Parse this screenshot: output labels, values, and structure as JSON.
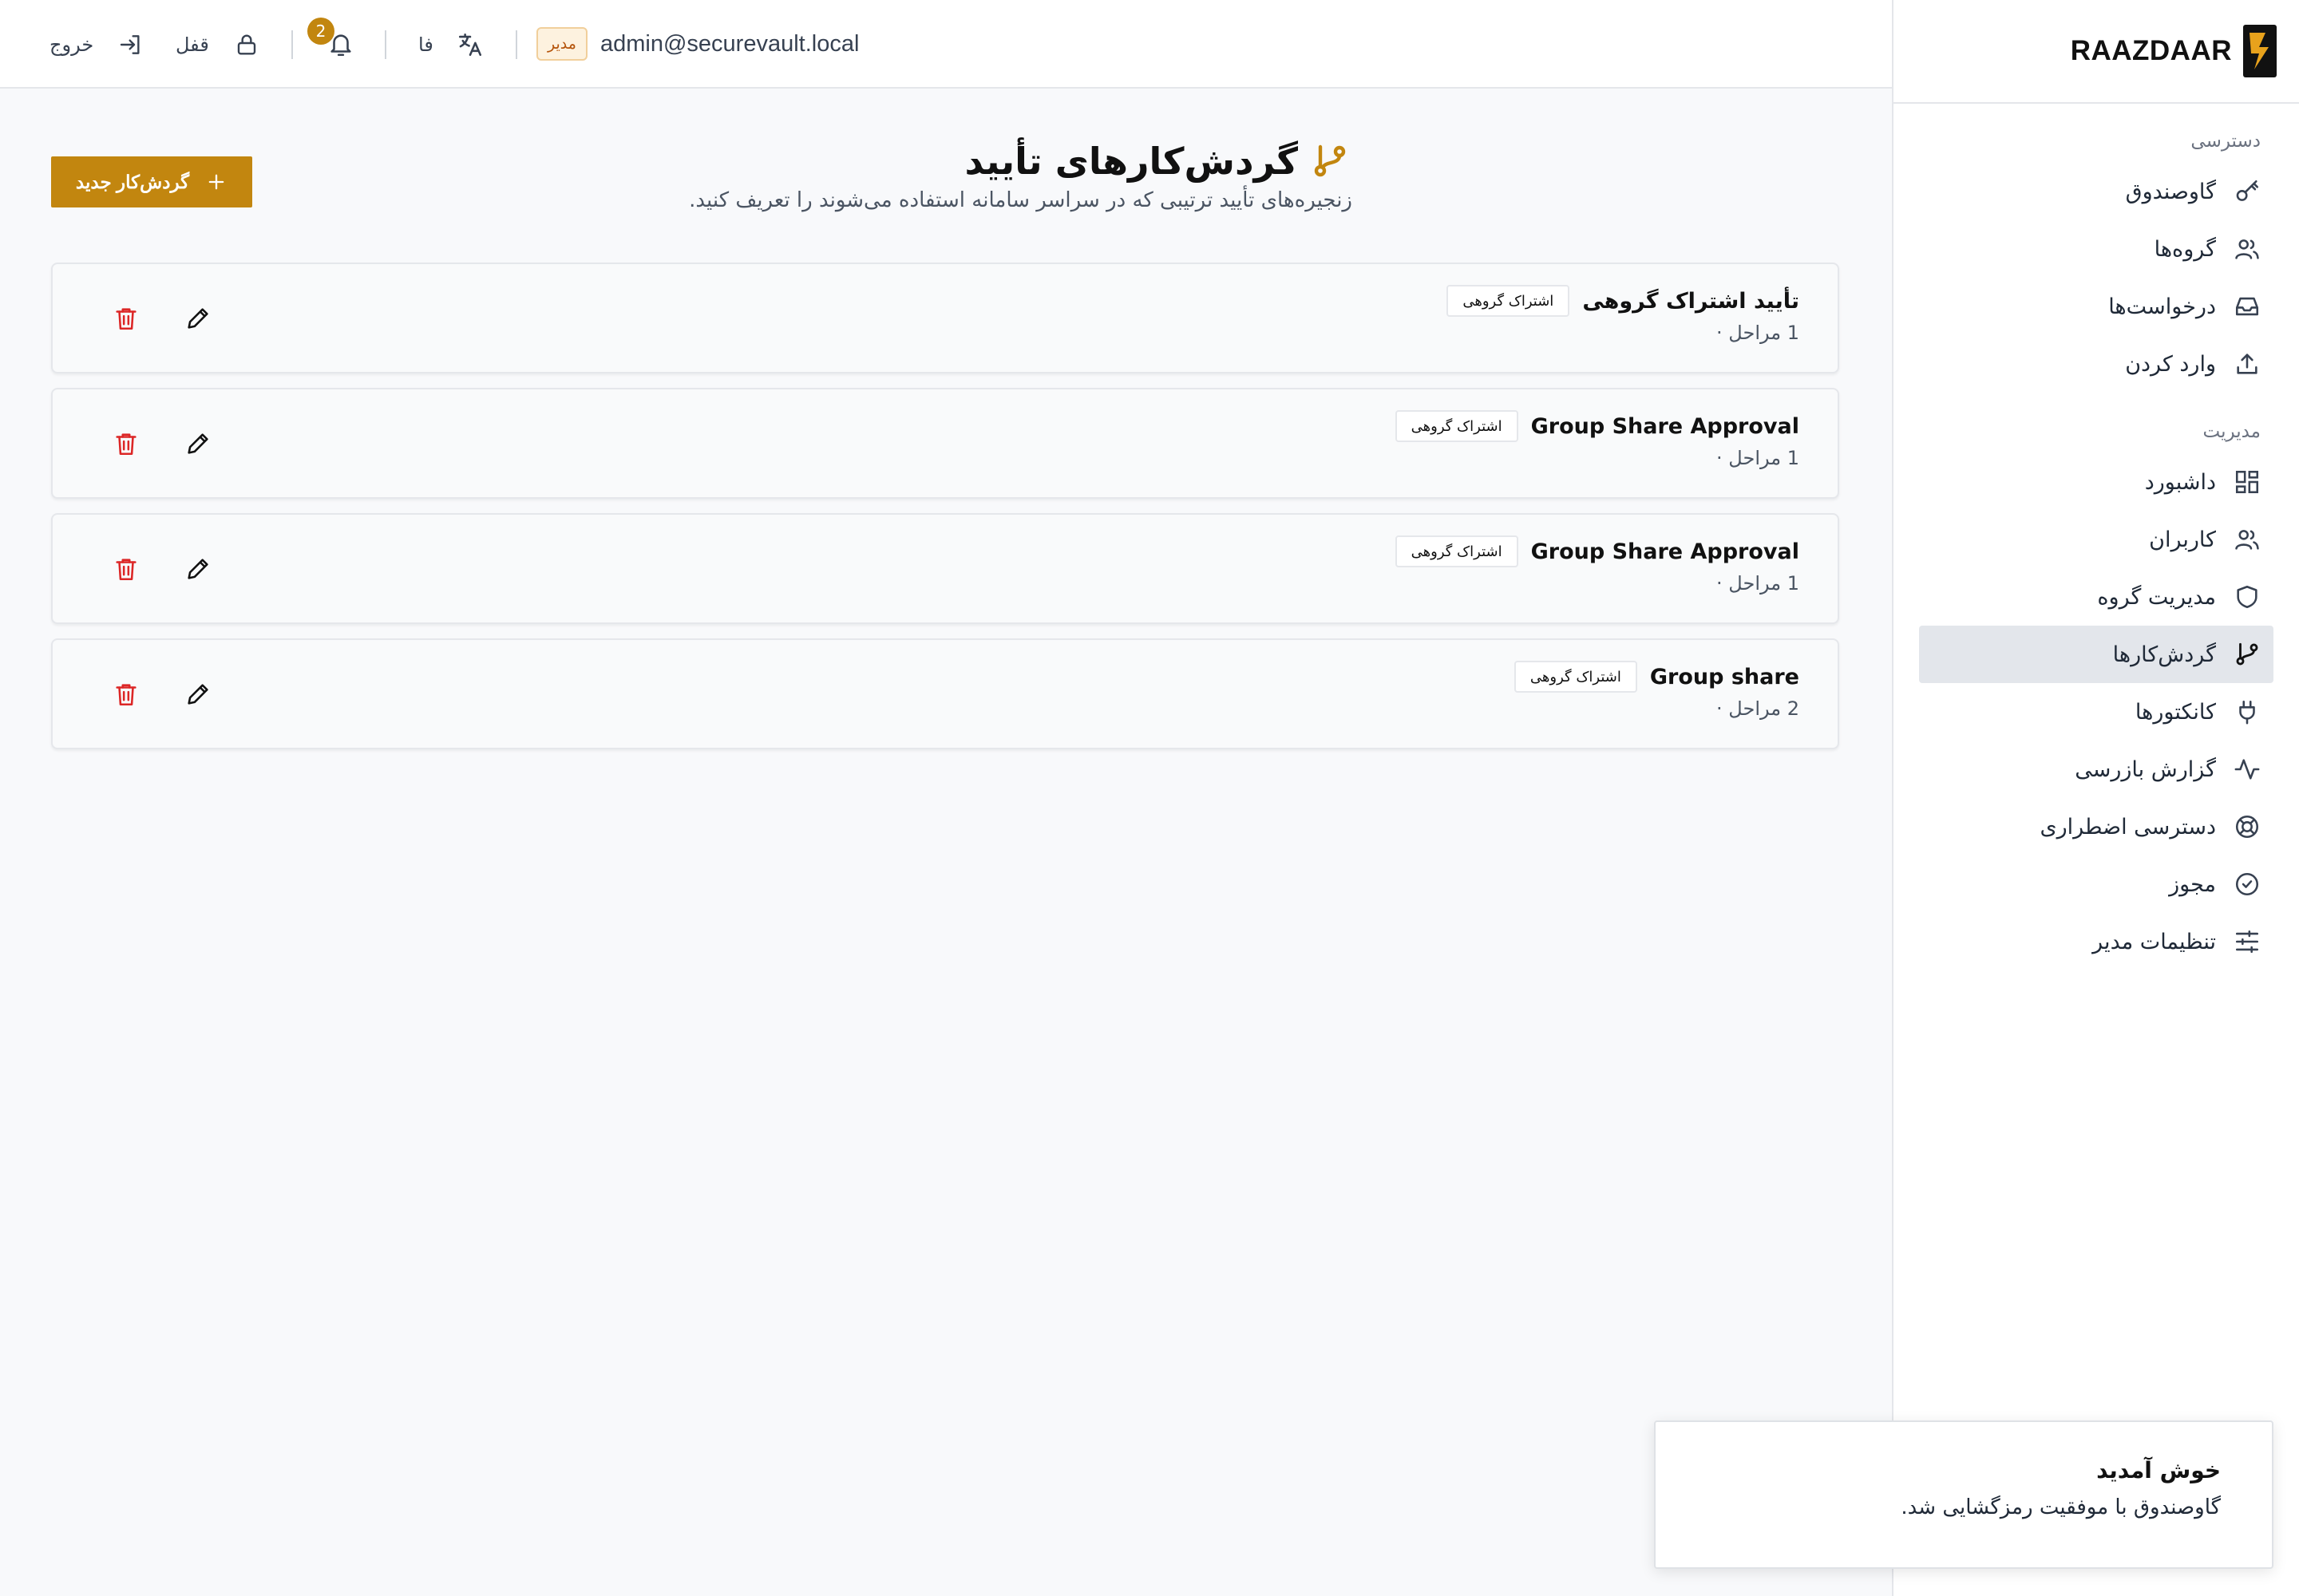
{
  "brand": {
    "name": "RAAZDAAR"
  },
  "topbar": {
    "email": "admin@securevault.local",
    "role_badge": "مدیر",
    "language": "فا",
    "notification_count": "2",
    "lock_label": "قفل",
    "logout_label": "خروج"
  },
  "sidebar": {
    "access_label": "دسترسی",
    "access_items": [
      {
        "label": "گاوصندوق",
        "icon": "vault-key-icon"
      },
      {
        "label": "گروه‌ها",
        "icon": "users-icon"
      },
      {
        "label": "درخواست‌ها",
        "icon": "inbox-icon"
      },
      {
        "label": "وارد کردن",
        "icon": "upload-icon"
      }
    ],
    "admin_label": "مدیریت",
    "admin_items": [
      {
        "label": "داشبورد",
        "icon": "dashboard-icon"
      },
      {
        "label": "کاربران",
        "icon": "users-icon"
      },
      {
        "label": "مدیریت گروه",
        "icon": "shield-icon"
      },
      {
        "label": "گردش‌کارها",
        "icon": "workflow-icon",
        "active": true
      },
      {
        "label": "کانکتورها",
        "icon": "plug-icon"
      },
      {
        "label": "گزارش بازرسی",
        "icon": "activity-icon"
      },
      {
        "label": "دسترسی اضطراری",
        "icon": "lifebuoy-icon"
      },
      {
        "label": "مجوز",
        "icon": "badge-check-icon"
      },
      {
        "label": "تنظیمات مدیر",
        "icon": "sliders-icon"
      }
    ]
  },
  "page": {
    "title": "گردش‌کارهای تأیید",
    "subtitle": "زنجیره‌های تأیید ترتیبی که در سراسر سامانه استفاده می‌شوند را تعریف کنید.",
    "new_button": "گردش‌کار جدید"
  },
  "workflows": [
    {
      "name": "تأیید اشتراک گروهی",
      "tag": "اشتراک گروهی",
      "steps": "1 مراحل ·"
    },
    {
      "name": "Group Share Approval",
      "tag": "اشتراک گروهی",
      "steps": "1 مراحل ·"
    },
    {
      "name": "Group Share Approval",
      "tag": "اشتراک گروهی",
      "steps": "1 مراحل ·"
    },
    {
      "name": "Group share",
      "tag": "اشتراک گروهی",
      "steps": "2 مراحل ·"
    }
  ],
  "toast": {
    "title": "خوش آمدید",
    "message": "گاوصندوق با موفقیت رمزگشایی شد."
  },
  "colors": {
    "accent": "#c2860f",
    "danger": "#dc2626",
    "active_nav": "#e3e6eb"
  }
}
